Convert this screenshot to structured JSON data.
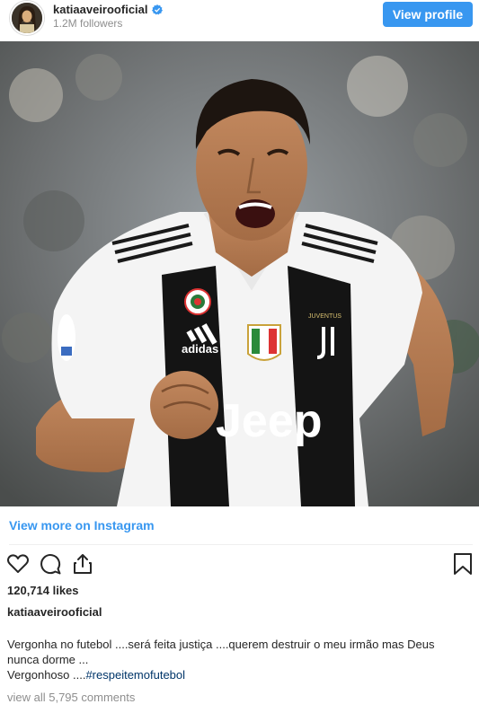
{
  "header": {
    "username": "katiaaveirooficial",
    "followers": "1.2M followers",
    "view_profile_label": "View profile"
  },
  "photo": {
    "jersey_brand": "adidas",
    "jersey_sponsor": "Jeep",
    "jersey_club": "JUVENTUS"
  },
  "view_more_label": "View more on Instagram",
  "actions": {
    "like_icon": "heart-icon",
    "comment_icon": "comment-icon",
    "share_icon": "share-icon",
    "save_icon": "bookmark-icon"
  },
  "likes": "120,714 likes",
  "caption": {
    "username": "katiaaveirooficial",
    "line1": "Vergonha no futebol ....será feita justiça ....querem destruir o meu irmão mas Deus",
    "line2": "nunca dorme ...",
    "line3_prefix": "Vergonhoso ....",
    "hashtag": "#respeitemofutebol"
  },
  "view_comments": "view all 5,795 comments",
  "colors": {
    "accent": "#3897f0",
    "text": "#262626",
    "muted": "#8e8e8e",
    "hashtag": "#003569"
  }
}
